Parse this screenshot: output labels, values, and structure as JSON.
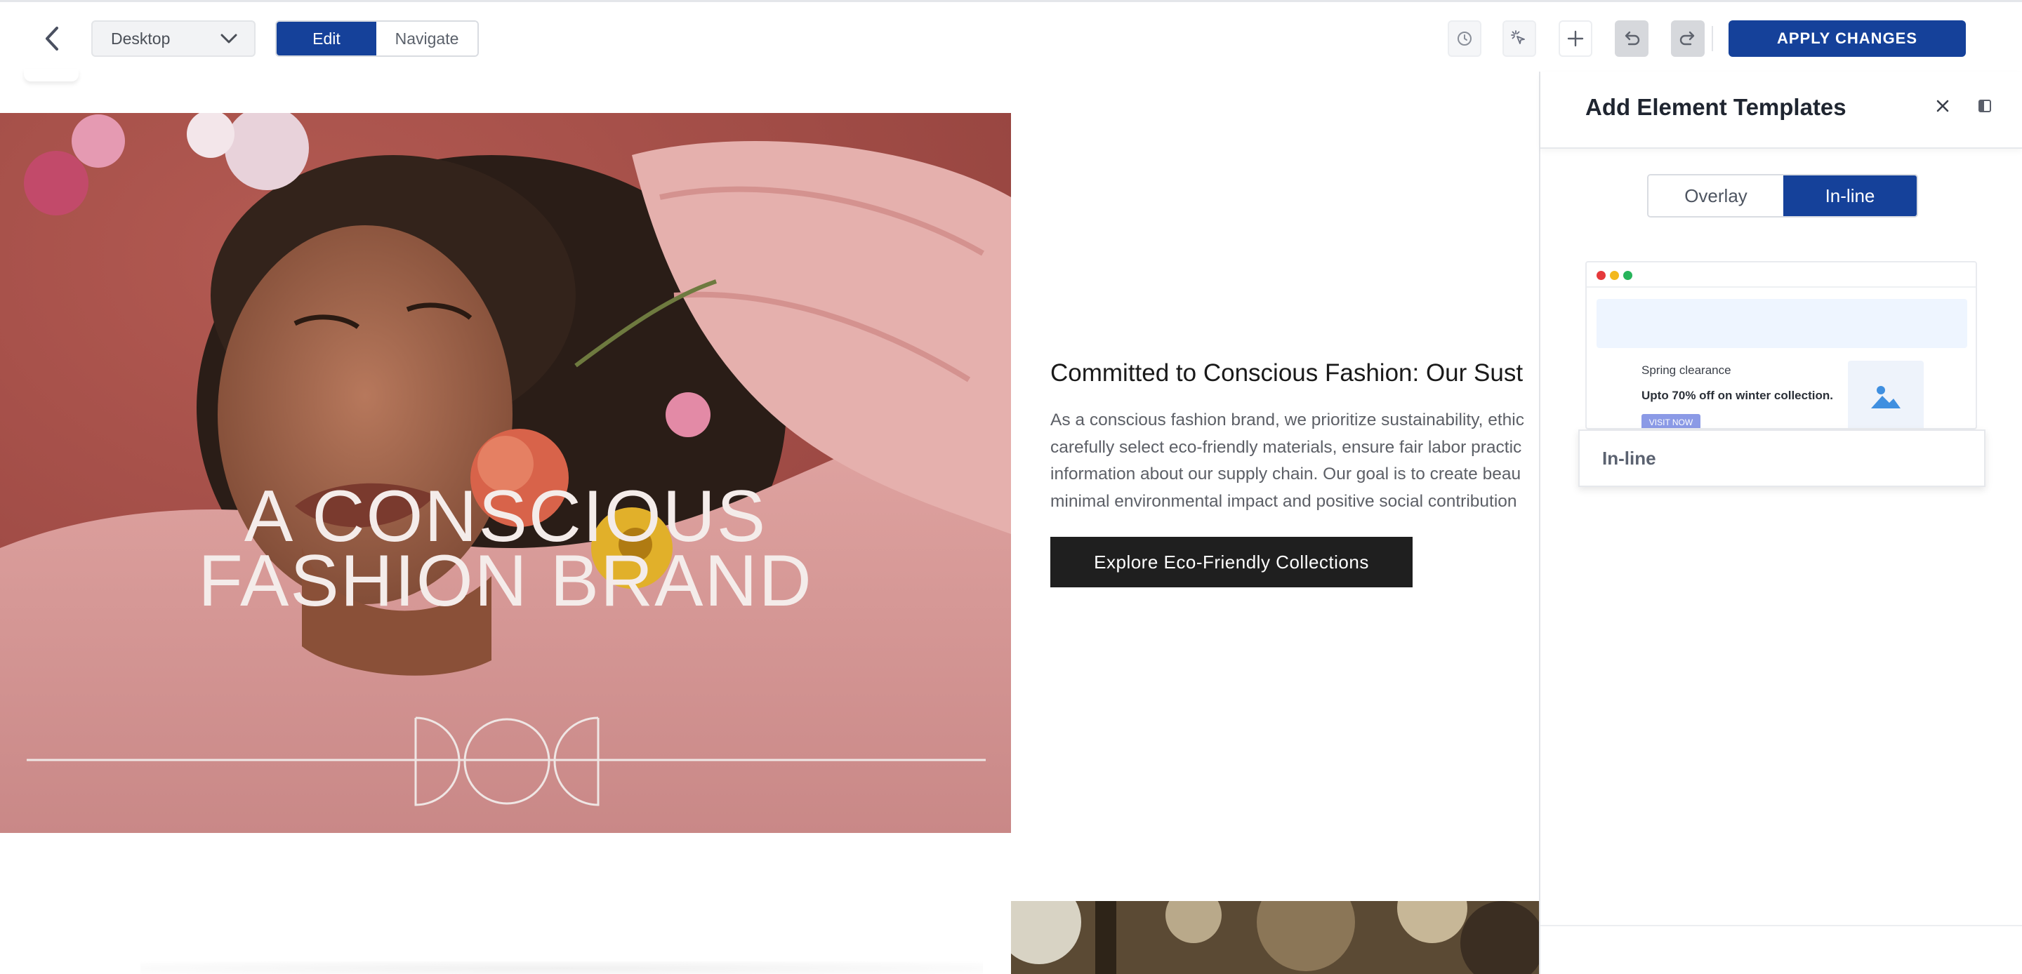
{
  "toolbar": {
    "device_select": "Desktop",
    "mode_edit": "Edit",
    "mode_navigate": "Navigate",
    "icons": [
      "history-icon",
      "magic-cursor-icon",
      "plus-icon",
      "undo-icon",
      "redo-icon"
    ],
    "apply_label": "APPLY CHANGES"
  },
  "canvas": {
    "hero_text_line1": "A CONSCIOUS",
    "hero_text_line2": "FASHION BRAND",
    "headline": "Committed to Conscious Fashion: Our Sust",
    "body_lines": [
      "As a conscious fashion brand, we prioritize sustainability, ethic",
      "carefully select eco-friendly materials, ensure fair labor practic",
      "information about our supply chain. Our goal is to create beau",
      "minimal environmental impact and positive social contribution"
    ],
    "cta_label": "Explore Eco-Friendly Collections"
  },
  "panel": {
    "title": "Add Element Templates",
    "tab_overlay": "Overlay",
    "tab_inline": "In-line",
    "template": {
      "line1": "Spring clearance",
      "line2": "Upto 70% off on winter collection.",
      "button": "VISIT NOW",
      "label": "In-line"
    }
  },
  "colors": {
    "primary": "#15419a",
    "cta_bg": "#1f1f1f",
    "dot_red": "#e5393b",
    "dot_yellow": "#f3b81d",
    "dot_green": "#27b45b"
  }
}
